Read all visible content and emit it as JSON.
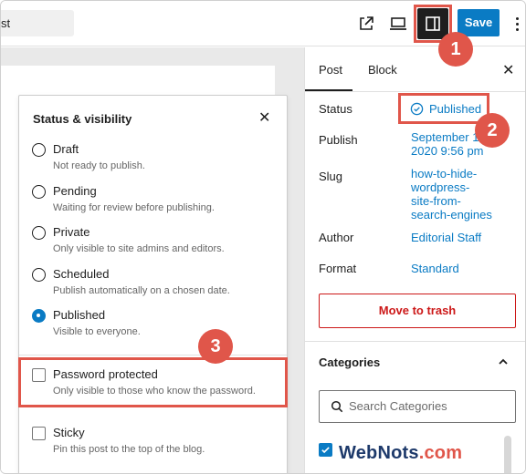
{
  "header": {
    "title_fragment": "st",
    "save_label": "Save",
    "icons": [
      "external-link-icon",
      "desktop-preview-icon",
      "sidebar-toggle-icon",
      "more-options-icon"
    ]
  },
  "markers": [
    "1",
    "2",
    "3"
  ],
  "popover": {
    "title": "Status & visibility",
    "options": [
      {
        "label": "Draft",
        "desc": "Not ready to publish.",
        "checked": false
      },
      {
        "label": "Pending",
        "desc": "Waiting for review before publishing.",
        "checked": false
      },
      {
        "label": "Private",
        "desc": "Only visible to site admins and editors.",
        "checked": false
      },
      {
        "label": "Scheduled",
        "desc": "Publish automatically on a chosen date.",
        "checked": false
      },
      {
        "label": "Published",
        "desc": "Visible to everyone.",
        "checked": true
      }
    ],
    "password": {
      "label": "Password protected",
      "desc": "Only visible to those who know the password.",
      "checked": false
    },
    "sticky": {
      "label": "Sticky",
      "desc": "Pin this post to the top of the blog.",
      "checked": false
    }
  },
  "sidebar": {
    "tabs": {
      "post": "Post",
      "block": "Block"
    },
    "status_label": "Status",
    "status_value": "Published",
    "publish_label": "Publish",
    "publish_line1": "September 14,",
    "publish_line2": "2020 9:56 pm",
    "slug_label": "Slug",
    "slug_lines": [
      "how-to-hide-",
      "wordpress-",
      "site-from-",
      "search-engines"
    ],
    "author_label": "Author",
    "author_value": "Editorial Staff",
    "format_label": "Format",
    "format_value": "Standard",
    "trash_label": "Move to trash",
    "categories_heading": "Categories",
    "categories_search_placeholder": "Search Categories"
  },
  "watermark": {
    "brand": "WebNots",
    "suffix": ".com"
  },
  "colors": {
    "accent": "#0a7bc4",
    "marker": "#e0564a",
    "danger": "#cc1818"
  }
}
